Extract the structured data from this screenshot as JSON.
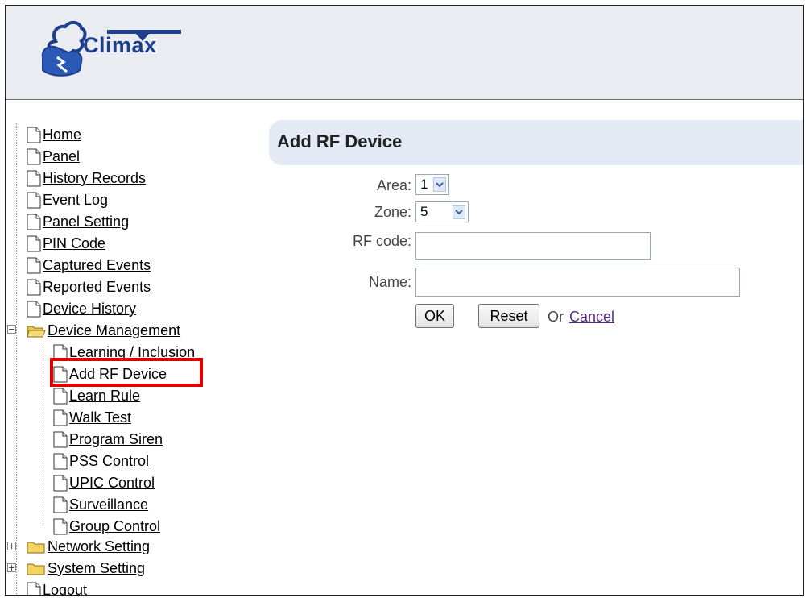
{
  "header": {
    "logo_text": "Climax"
  },
  "nav": {
    "top_items": [
      "Home",
      "Panel",
      "History Records",
      "Event Log",
      "Panel Setting",
      "PIN Code",
      "Captured Events",
      "Reported Events",
      "Device History"
    ],
    "device_management": {
      "label": "Device Management",
      "children": [
        "Learning / Inclusion",
        "Add RF Device",
        "Learn Rule",
        "Walk Test",
        "Program Siren",
        "PSS Control",
        "UPIC Control",
        "Surveillance",
        "Group Control"
      ]
    },
    "network_setting": "Network Setting",
    "system_setting": "System Setting",
    "logout": "Logout",
    "highlighted_item": "Add RF Device"
  },
  "main": {
    "title": "Add RF Device",
    "form": {
      "area_label": "Area:",
      "area_value": "1",
      "zone_label": "Zone:",
      "zone_value": "5",
      "rf_code_label": "RF code:",
      "rf_code_value": "",
      "name_label": "Name:",
      "name_value": "",
      "ok_label": "OK",
      "reset_label": "Reset",
      "or_text": "Or",
      "cancel_label": "Cancel"
    }
  },
  "colors": {
    "header_bg": "#e9edf1",
    "title_bar_bg": "#e3eaf4",
    "highlight": "#e00000",
    "logo_blue": "#1d3f8d"
  }
}
